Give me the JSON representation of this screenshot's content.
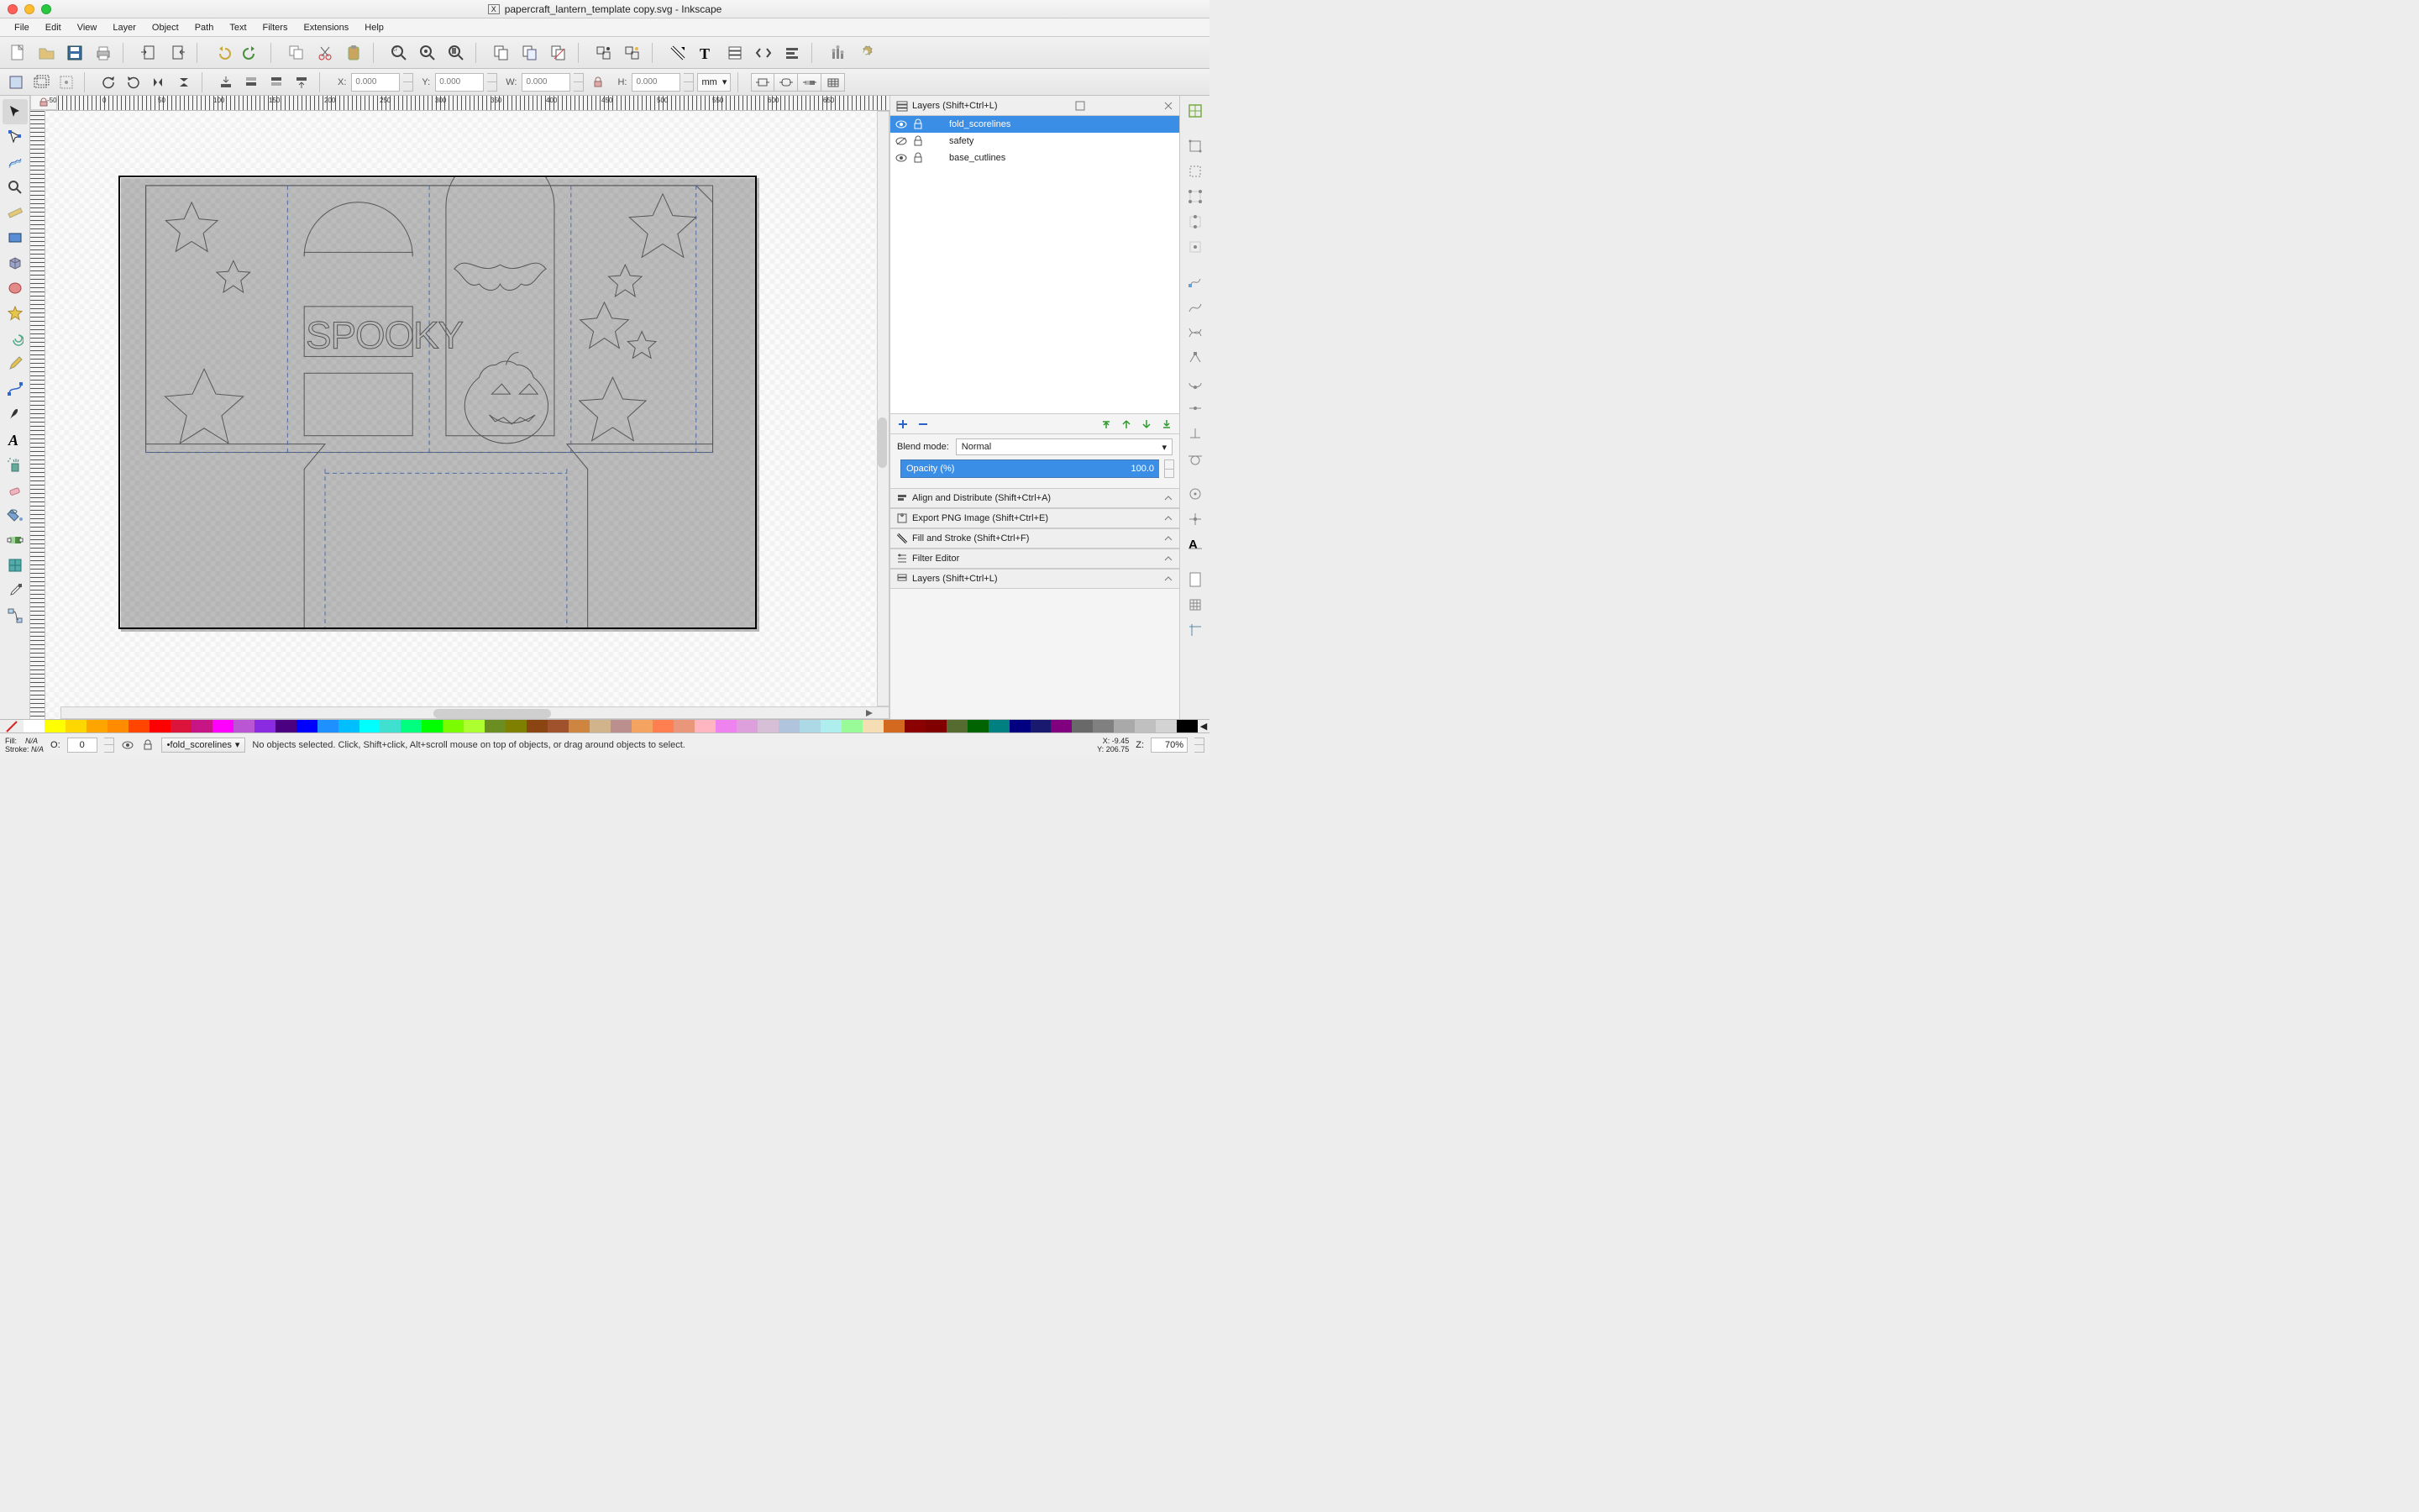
{
  "window_title": "papercraft_lantern_template copy.svg - Inkscape",
  "menus": [
    "File",
    "Edit",
    "View",
    "Layer",
    "Object",
    "Path",
    "Text",
    "Filters",
    "Extensions",
    "Help"
  ],
  "options": {
    "x": "0.000",
    "y": "0.000",
    "w": "0.000",
    "h": "0.000",
    "unit": "mm"
  },
  "hruler": [
    "-50",
    "0",
    "50",
    "100",
    "150",
    "200",
    "250",
    "300",
    "350",
    "400",
    "450",
    "500",
    "550",
    "600",
    "650"
  ],
  "layerspanel": {
    "title": "Layers (Shift+Ctrl+L)",
    "layers": [
      {
        "name": "fold_scorelines",
        "visible": true,
        "locked": false,
        "selected": true
      },
      {
        "name": "safety",
        "visible": false,
        "locked": false,
        "selected": false
      },
      {
        "name": "base_cutlines",
        "visible": true,
        "locked": false,
        "selected": false
      }
    ],
    "blend_label": "Blend mode:",
    "blend_value": "Normal",
    "opacity_label": "Opacity (%)",
    "opacity_value": "100.0"
  },
  "collapsed_panels": [
    "Align and Distribute (Shift+Ctrl+A)",
    "Export PNG Image (Shift+Ctrl+E)",
    "Fill and Stroke (Shift+Ctrl+F)",
    "Filter Editor",
    "Layers (Shift+Ctrl+L)"
  ],
  "palette": [
    "#ffffff",
    "#ffff00",
    "#ffd700",
    "#ffa500",
    "#ff8c00",
    "#ff4500",
    "#ff0000",
    "#dc143c",
    "#c71585",
    "#ff00ff",
    "#ba55d3",
    "#8a2be2",
    "#4b0082",
    "#0000ff",
    "#1e90ff",
    "#00bfff",
    "#00ffff",
    "#40e0d0",
    "#00ff7f",
    "#00ff00",
    "#7cfc00",
    "#adff2f",
    "#6b8e23",
    "#808000",
    "#8b4513",
    "#a0522d",
    "#cd853f",
    "#d2b48c",
    "#bc8f8f",
    "#f4a460",
    "#ff7f50",
    "#e9967a",
    "#ffb6c1",
    "#ee82ee",
    "#dda0dd",
    "#d8bfd8",
    "#b0c4de",
    "#add8e6",
    "#afeeee",
    "#98fb98",
    "#f5deb3",
    "#d2691e",
    "#8b0000",
    "#800000",
    "#556b2f",
    "#006400",
    "#008080",
    "#000080",
    "#191970",
    "#800080",
    "#696969",
    "#808080",
    "#a9a9a9",
    "#c0c0c0",
    "#d3d3d3",
    "#000000"
  ],
  "status": {
    "fill": "N/A",
    "stroke": "N/A",
    "o_label": "O:",
    "o_value": "0",
    "layer": "•fold_scorelines",
    "message": "No objects selected. Click, Shift+click, Alt+scroll mouse on top of objects, or drag around objects to select.",
    "x": "-9.45",
    "y": "206.75",
    "z_label": "Z:",
    "zoom": "70%"
  }
}
